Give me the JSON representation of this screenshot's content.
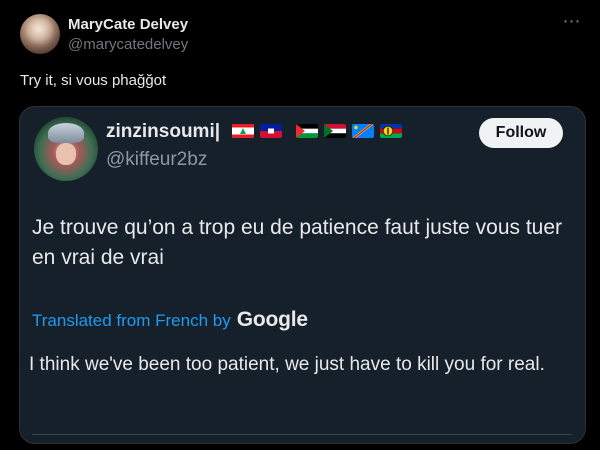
{
  "post": {
    "author_name": "MaryCate Delvey",
    "author_handle": "@marycatedelvey",
    "more_icon": "⋯",
    "text": "Try it, si vous phağğot"
  },
  "quoted_post": {
    "author_name": "zinzinsoumi|",
    "flags": [
      "lebanon-flag",
      "haiti-flag",
      "palestine-flag",
      "sudan-flag",
      "dr-congo-flag",
      "new-caledonia-flag"
    ],
    "author_handle": "@kiffeur2bz",
    "follow_label": "Follow",
    "text": "Je trouve qu’on a trop eu de patience faut juste vous tuer en vrai de vrai",
    "translated_label": "Translated from French by",
    "translator_brand": "Google",
    "translation": "I think we've been too patient, we just have to kill you for real."
  },
  "colors": {
    "background": "#000000",
    "card": "#15202b",
    "accent_link": "#1d9bf0",
    "follow_bg": "#eff3f4"
  }
}
